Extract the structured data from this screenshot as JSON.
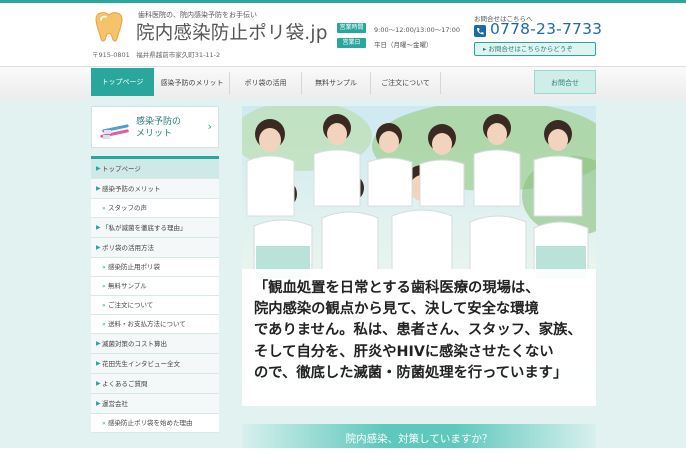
{
  "header": {
    "tagline": "歯科医院の、院内感染予防をお手伝い",
    "site_title": "院内感染防止ポリ袋.jp",
    "address": "〒915-0801　福井県越前市家久町31-11-2",
    "hours_badge": "営業時間",
    "hours_text": "9:00～12:00/13:00～17:00",
    "holiday_badge": "営業日",
    "holiday_text": "平日（月曜～金曜）",
    "contact_caption": "お問合せはこちらへ",
    "phone": "0778-23-7733",
    "contact_button": "お問合せはこちらからどうぞ"
  },
  "nav": {
    "items": [
      "トップページ",
      "感染予防のメリット",
      "ポリ袋の活用",
      "無料サンプル",
      "ご注文について",
      "お問合せ"
    ]
  },
  "sidebar": {
    "banner_line1": "感染予防の",
    "banner_line2": "メリット",
    "items": [
      {
        "label": "トップページ",
        "level": 1
      },
      {
        "label": "感染予防のメリット",
        "level": 1
      },
      {
        "label": "スタッフの声",
        "level": 2
      },
      {
        "label": "「私が滅菌を徹底する理由」",
        "level": 1
      },
      {
        "label": "ポリ袋の活用方法",
        "level": 1
      },
      {
        "label": "感染防止用ポリ袋",
        "level": 2
      },
      {
        "label": "無料サンプル",
        "level": 2
      },
      {
        "label": "ご注文について",
        "level": 2
      },
      {
        "label": "送料・お支払方法について",
        "level": 2
      },
      {
        "label": "滅菌対策のコスト算出",
        "level": 1
      },
      {
        "label": "花田先生インタビュー全文",
        "level": 1
      },
      {
        "label": "よくあるご質問",
        "level": 1
      },
      {
        "label": "運営会社",
        "level": 1
      },
      {
        "label": "感染防止ポリ袋を始めた理由",
        "level": 2
      }
    ]
  },
  "hero": {
    "quote_lines": [
      "「観血処置を日常とする歯科医療の現場は、",
      "院内感染の観点から見て、決して安全な環境",
      "でありません。私は、患者さん、スタッフ、家族、",
      "そして自分を、肝炎やHIVに感染させたくない",
      "ので、徹底した滅菌・防菌処理を行っています」"
    ]
  },
  "bottom_banner": "院内感染、対策していますか？",
  "colors": {
    "accent": "#2aa79d",
    "phone": "#1d6aa5",
    "content_bg": "#e2f2f1"
  },
  "icons": {
    "logo": "tooth-icon",
    "phone": "phone-icon",
    "banner": "toothbrush-icon"
  }
}
